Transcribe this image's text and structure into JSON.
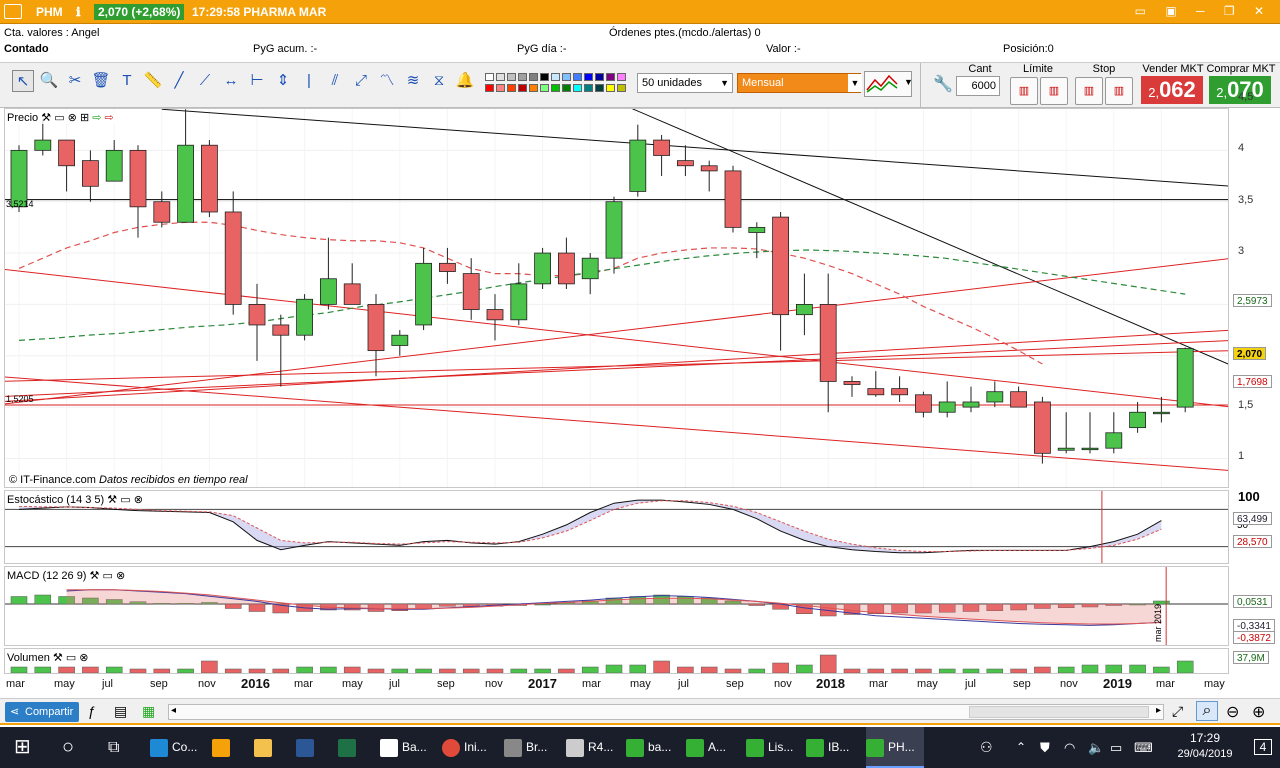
{
  "titlebar": {
    "menu_icon": "hamburger-icon",
    "symbol": "PHM",
    "price_badge": "2,070 (+2,68%)",
    "time_company": "17:29:58 PHARMA MAR"
  },
  "info": {
    "account": "Cta. valores : Angel",
    "orders": "Órdenes ptes.(mcdo./alertas)  0",
    "mode": "Contado",
    "pyg_acum": "PyG acum. :-",
    "pyg_dia": "PyG día :-",
    "valor": "Valor :-",
    "posicion": "Posición:0"
  },
  "toolbar": {
    "units": "50 unidades",
    "period": "Mensual",
    "cant_label": "Cant",
    "cant_value": "6000",
    "limite_label": "Límite",
    "stop_label": "Stop",
    "vender_label": "Vender MKT",
    "vender_small": "2,",
    "vender_big": "062",
    "comprar_label": "Comprar MKT",
    "comprar_small": "2,",
    "comprar_big": "070",
    "tools": [
      "cursor-icon",
      "zoom-icon",
      "settings-icon",
      "trash-icon",
      "text-icon",
      "ruler-icon",
      "trendline-icon",
      "trendline2-icon",
      "horizontal-icon",
      "segment-icon",
      "vertical-icon",
      "vline-icon",
      "channel-icon",
      "expand-icon",
      "zigzag-icon",
      "wave-icon",
      "pattern-icon",
      "alert-bell-icon"
    ],
    "colors": [
      "#ffffff",
      "#e0e0e0",
      "#c0c0c0",
      "#a0a0a0",
      "#808080",
      "#000000",
      "#c8e8ff",
      "#80c0ff",
      "#4080ff",
      "#0000ff",
      "#0000a0",
      "#800080",
      "#ff80ff",
      "#ff0000",
      "#ff8080",
      "#ff4000",
      "#c00000",
      "#ff8000",
      "#80ff80",
      "#00c000",
      "#008000",
      "#00ffff",
      "#008080",
      "#004040",
      "#ffff00",
      "#c0c000"
    ]
  },
  "price_pane": {
    "title": "Precio",
    "copyright": "© IT-Finance.com",
    "realtime": "Datos recibidos en tiempo real",
    "left_3521": "3,5214",
    "left_1520": "1,5205",
    "yticks": [
      "4,5",
      "4",
      "3,5",
      "3",
      "2,5",
      "2",
      "1,5",
      "1"
    ],
    "tag_ma": "2,5973",
    "tag_last": "2,070",
    "tag_red": "1,7698"
  },
  "stoch_pane": {
    "title": "Estocástico (14 3 5)",
    "top": "100",
    "mid": "50",
    "tag1": "63,499",
    "tag2": "28,570"
  },
  "macd_pane": {
    "title": "MACD (12 26 9)",
    "tag1": "0,0531",
    "tag2": "-0,3341",
    "tag3": "-0,3872",
    "cursor_label": "mar 2019"
  },
  "vol_pane": {
    "title": "Volumen",
    "tag": "37,9M"
  },
  "chart_data": {
    "type": "candlestick",
    "symbol": "PHM",
    "period": "Mensual",
    "ylim": [
      0.8,
      4.5
    ],
    "candles": [
      {
        "o": 3.45,
        "h": 4.05,
        "l": 3.4,
        "c": 4.0
      },
      {
        "o": 4.0,
        "h": 4.3,
        "l": 3.95,
        "c": 4.1
      },
      {
        "o": 4.1,
        "h": 4.1,
        "l": 3.6,
        "c": 3.85
      },
      {
        "o": 3.9,
        "h": 4.0,
        "l": 3.5,
        "c": 3.65
      },
      {
        "o": 3.7,
        "h": 4.1,
        "l": 3.7,
        "c": 4.0
      },
      {
        "o": 4.0,
        "h": 4.05,
        "l": 3.15,
        "c": 3.45
      },
      {
        "o": 3.5,
        "h": 3.6,
        "l": 3.25,
        "c": 3.3
      },
      {
        "o": 3.3,
        "h": 4.4,
        "l": 3.3,
        "c": 4.05
      },
      {
        "o": 4.05,
        "h": 4.1,
        "l": 3.35,
        "c": 3.4
      },
      {
        "o": 3.4,
        "h": 3.6,
        "l": 2.4,
        "c": 2.5
      },
      {
        "o": 2.5,
        "h": 2.7,
        "l": 1.95,
        "c": 2.3
      },
      {
        "o": 2.3,
        "h": 2.4,
        "l": 1.7,
        "c": 2.2
      },
      {
        "o": 2.2,
        "h": 2.6,
        "l": 2.15,
        "c": 2.55
      },
      {
        "o": 2.5,
        "h": 3.15,
        "l": 2.45,
        "c": 2.75
      },
      {
        "o": 2.7,
        "h": 2.9,
        "l": 2.5,
        "c": 2.5
      },
      {
        "o": 2.5,
        "h": 2.6,
        "l": 1.8,
        "c": 2.05
      },
      {
        "o": 2.1,
        "h": 2.25,
        "l": 2.0,
        "c": 2.2
      },
      {
        "o": 2.3,
        "h": 3.05,
        "l": 2.25,
        "c": 2.9
      },
      {
        "o": 2.9,
        "h": 3.05,
        "l": 2.7,
        "c": 2.82
      },
      {
        "o": 2.8,
        "h": 2.95,
        "l": 2.35,
        "c": 2.45
      },
      {
        "o": 2.45,
        "h": 2.6,
        "l": 2.15,
        "c": 2.35
      },
      {
        "o": 2.35,
        "h": 2.9,
        "l": 2.3,
        "c": 2.7
      },
      {
        "o": 2.7,
        "h": 3.05,
        "l": 2.65,
        "c": 3.0
      },
      {
        "o": 3.0,
        "h": 3.15,
        "l": 2.65,
        "c": 2.7
      },
      {
        "o": 2.75,
        "h": 3.0,
        "l": 2.6,
        "c": 2.95
      },
      {
        "o": 2.95,
        "h": 3.55,
        "l": 2.8,
        "c": 3.5
      },
      {
        "o": 3.6,
        "h": 4.25,
        "l": 3.55,
        "c": 4.1
      },
      {
        "o": 4.1,
        "h": 4.15,
        "l": 3.75,
        "c": 3.95
      },
      {
        "o": 3.9,
        "h": 4.05,
        "l": 3.75,
        "c": 3.85
      },
      {
        "o": 3.85,
        "h": 3.9,
        "l": 3.6,
        "c": 3.8
      },
      {
        "o": 3.8,
        "h": 3.85,
        "l": 3.2,
        "c": 3.25
      },
      {
        "o": 3.2,
        "h": 3.3,
        "l": 2.95,
        "c": 3.25
      },
      {
        "o": 3.35,
        "h": 3.4,
        "l": 2.05,
        "c": 2.4
      },
      {
        "o": 2.4,
        "h": 2.8,
        "l": 2.2,
        "c": 2.5
      },
      {
        "o": 2.5,
        "h": 2.8,
        "l": 1.45,
        "c": 1.75
      },
      {
        "o": 1.75,
        "h": 1.8,
        "l": 1.6,
        "c": 1.72
      },
      {
        "o": 1.68,
        "h": 1.85,
        "l": 1.6,
        "c": 1.62
      },
      {
        "o": 1.68,
        "h": 1.8,
        "l": 1.55,
        "c": 1.62
      },
      {
        "o": 1.62,
        "h": 1.65,
        "l": 1.4,
        "c": 1.45
      },
      {
        "o": 1.45,
        "h": 1.75,
        "l": 1.4,
        "c": 1.55
      },
      {
        "o": 1.5,
        "h": 1.7,
        "l": 1.45,
        "c": 1.55
      },
      {
        "o": 1.55,
        "h": 1.75,
        "l": 1.5,
        "c": 1.65
      },
      {
        "o": 1.65,
        "h": 1.7,
        "l": 1.5,
        "c": 1.5
      },
      {
        "o": 1.55,
        "h": 1.6,
        "l": 0.95,
        "c": 1.05
      },
      {
        "o": 1.08,
        "h": 1.45,
        "l": 1.05,
        "c": 1.1
      },
      {
        "o": 1.1,
        "h": 1.45,
        "l": 1.05,
        "c": 1.1
      },
      {
        "o": 1.1,
        "h": 1.45,
        "l": 1.05,
        "c": 1.25
      },
      {
        "o": 1.3,
        "h": 1.55,
        "l": 1.25,
        "c": 1.45
      },
      {
        "o": 1.45,
        "h": 1.6,
        "l": 1.35,
        "c": 1.45
      },
      {
        "o": 1.5,
        "h": 2.08,
        "l": 1.45,
        "c": 2.07
      }
    ],
    "x_labels": [
      "mar",
      "may",
      "jul",
      "sep",
      "nov",
      "2016",
      "mar",
      "may",
      "jul",
      "sep",
      "nov",
      "2017",
      "mar",
      "may",
      "jul",
      "sep",
      "nov",
      "2018",
      "mar",
      "may",
      "jul",
      "sep",
      "nov",
      "2019",
      "mar",
      "may"
    ]
  },
  "bottombar": {
    "share": "Compartir"
  },
  "taskbar": {
    "items": [
      {
        "label": "Co...",
        "icon": "edge-icon",
        "color": "#1e8ad6"
      },
      {
        "label": "",
        "icon": "store-icon",
        "color": "#f5a20a"
      },
      {
        "label": "",
        "icon": "folder-icon",
        "color": "#f2c14e"
      },
      {
        "label": "",
        "icon": "word-icon",
        "color": "#2b5797"
      },
      {
        "label": "",
        "icon": "excel-icon",
        "color": "#1e7145"
      },
      {
        "label": "Ba...",
        "icon": "mail-icon",
        "color": "#ffffff"
      },
      {
        "label": "Ini...",
        "icon": "chrome-icon",
        "color": "#e04a3b"
      },
      {
        "label": "Br...",
        "icon": "doc-icon",
        "color": "#888888"
      },
      {
        "label": "R4...",
        "icon": "app-icon",
        "color": "#cccccc"
      },
      {
        "label": "ba...",
        "icon": "chart-icon",
        "color": "#35b035"
      },
      {
        "label": "A...",
        "icon": "chart-icon",
        "color": "#35b035"
      },
      {
        "label": "Lis...",
        "icon": "chart-icon",
        "color": "#35b035"
      },
      {
        "label": "IB...",
        "icon": "chart-icon",
        "color": "#35b035"
      },
      {
        "label": "PH...",
        "icon": "chart-icon",
        "color": "#35b035"
      }
    ],
    "time": "17:29",
    "date": "29/04/2019",
    "notif": "4"
  }
}
